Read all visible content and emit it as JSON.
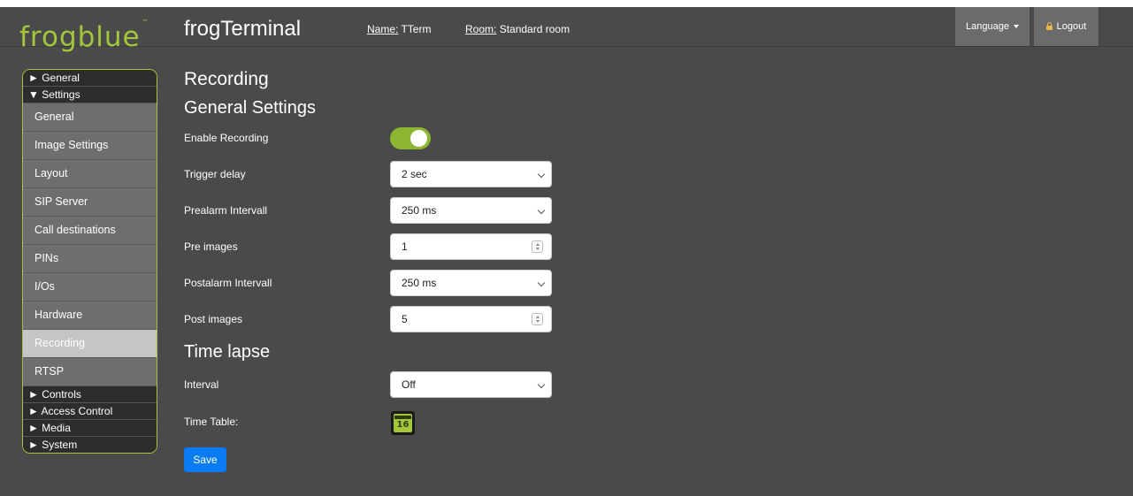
{
  "header": {
    "logo": "frogblue",
    "logo_tm": "™",
    "app_title": "frogTerminal",
    "name_label": "Name:",
    "name_value": "TTerm",
    "room_label": "Room:",
    "room_value": "Standard room",
    "language_label": "Language",
    "logout_label": "Logout"
  },
  "sidebar": {
    "general": "► General",
    "settings": "▼ Settings",
    "items": [
      "General",
      "Image Settings",
      "Layout",
      "SIP Server",
      "Call destinations",
      "PINs",
      "I/Os",
      "Hardware",
      "Recording",
      "RTSP"
    ],
    "active_item": "Recording",
    "controls": "► Controls",
    "access_control": "► Access Control",
    "media": "► Media",
    "system": "► System"
  },
  "page": {
    "title": "Recording",
    "general_heading": "General Settings",
    "enable_recording_label": "Enable Recording",
    "enable_recording_on": true,
    "trigger_delay_label": "Trigger delay",
    "trigger_delay_value": "2 sec",
    "prealarm_label": "Prealarm Intervall",
    "prealarm_value": "250 ms",
    "pre_images_label": "Pre images",
    "pre_images_value": "1",
    "postalarm_label": "Postalarm Intervall",
    "postalarm_value": "250 ms",
    "post_images_label": "Post images",
    "post_images_value": "5",
    "timelapse_heading": "Time lapse",
    "interval_label": "Interval",
    "interval_value": "Off",
    "timetable_label": "Time Table:",
    "calendar_day": "16",
    "save_label": "Save"
  },
  "colors": {
    "accent_green": "#a3c63b",
    "toggle_green": "#8cb62f",
    "save_blue": "#0a7cf2",
    "background": "#4a4a4a"
  }
}
